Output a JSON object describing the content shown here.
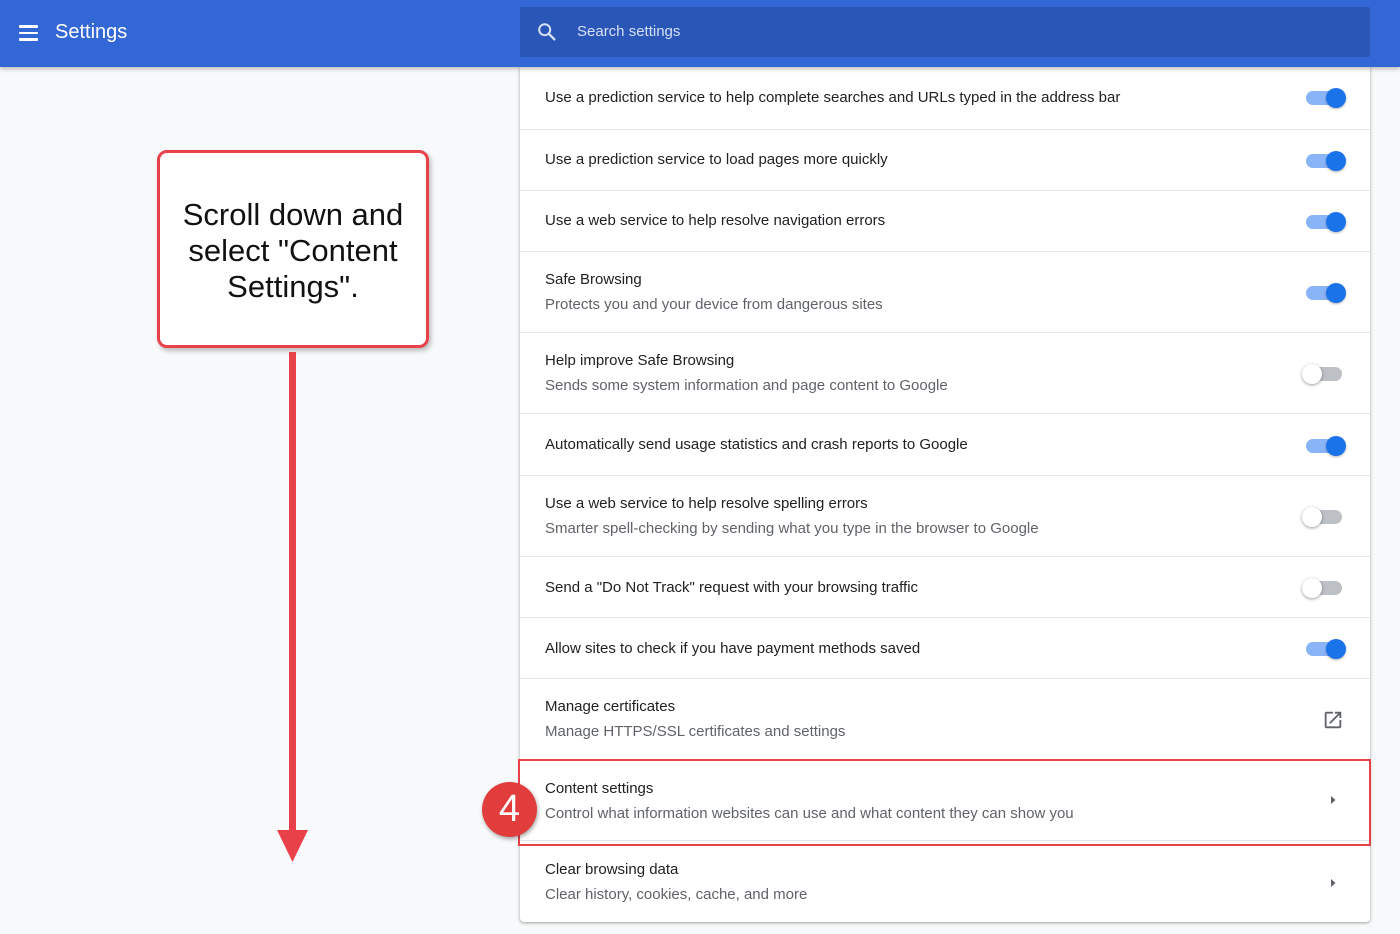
{
  "header": {
    "title": "Settings",
    "search_placeholder": "Search settings"
  },
  "rows": [
    {
      "label": "Use a prediction service to help complete searches and URLs typed in the address bar",
      "toggle": "on"
    },
    {
      "label": "Use a prediction service to load pages more quickly",
      "toggle": "on"
    },
    {
      "label": "Use a web service to help resolve navigation errors",
      "toggle": "on"
    },
    {
      "label": "Safe Browsing",
      "sublabel": "Protects you and your device from dangerous sites",
      "toggle": "on"
    },
    {
      "label": "Help improve Safe Browsing",
      "sublabel": "Sends some system information and page content to Google",
      "toggle": "off"
    },
    {
      "label": "Automatically send usage statistics and crash reports to Google",
      "toggle": "on"
    },
    {
      "label": "Use a web service to help resolve spelling errors",
      "sublabel": "Smarter spell-checking by sending what you type in the browser to Google",
      "toggle": "off"
    },
    {
      "label": "Send a \"Do Not Track\" request with your browsing traffic",
      "toggle": "off"
    },
    {
      "label": "Allow sites to check if you have payment methods saved",
      "toggle": "on"
    },
    {
      "label": "Manage certificates",
      "sublabel": "Manage HTTPS/SSL certificates and settings",
      "icon": "open-in-new-icon"
    },
    {
      "label": "Content settings",
      "sublabel": "Control what information websites can use and what content they can show you",
      "icon": "chevron-right-icon"
    },
    {
      "label": "Clear browsing data",
      "sublabel": "Clear history, cookies, cache, and more",
      "icon": "chevron-right-icon"
    }
  ],
  "annotation": {
    "callout_text": "Scroll down and select \"Content Settings\".",
    "step_number": "4",
    "accent_color": "#e8414a"
  },
  "colors": {
    "header_bg": "#3367d6",
    "search_bg": "#2a56b8",
    "toggle_on": "#1a73e8",
    "toggle_on_track": "#8ab4f8"
  }
}
